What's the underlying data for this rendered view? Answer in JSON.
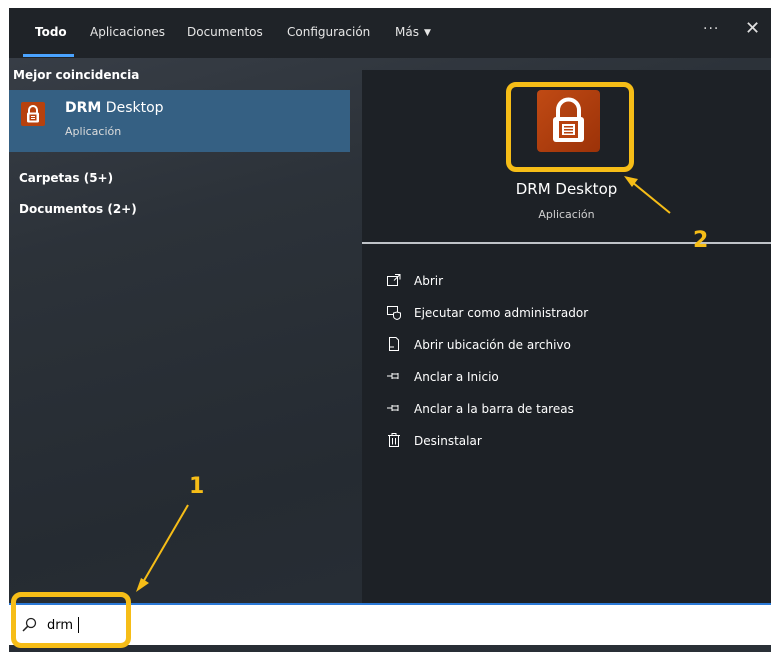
{
  "tabs": [
    {
      "label": "Todo"
    },
    {
      "label": "Aplicaciones"
    },
    {
      "label": "Documentos"
    },
    {
      "label": "Configuración"
    },
    {
      "label": "Más"
    }
  ],
  "header_icons": {
    "ellipsis": "···",
    "close": "✕"
  },
  "left": {
    "best_match_header": "Mejor coincidencia",
    "best_match": {
      "title_bold": "DRM",
      "title_rest": " Desktop",
      "subtitle": "Aplicación"
    },
    "categories": [
      "Carpetas (5+)",
      "Documentos (2+)"
    ]
  },
  "right": {
    "app_name": "DRM Desktop",
    "app_type": "Aplicación",
    "actions": [
      {
        "label": "Abrir",
        "icon": "open-icon"
      },
      {
        "label": "Ejecutar como administrador",
        "icon": "run-as-admin-icon"
      },
      {
        "label": "Abrir ubicación de archivo",
        "icon": "file-location-icon"
      },
      {
        "label": "Anclar a Inicio",
        "icon": "pin-icon"
      },
      {
        "label": "Anclar a la barra de tareas",
        "icon": "pin-icon"
      },
      {
        "label": "Desinstalar",
        "icon": "trash-icon"
      }
    ]
  },
  "search": {
    "value": "drm"
  },
  "annotations": {
    "one": "1",
    "two": "2",
    "color": "#f6bd17"
  },
  "colors": {
    "accent": "#4aa3ff",
    "selection": "#356083",
    "app_icon": "#b7410e"
  }
}
